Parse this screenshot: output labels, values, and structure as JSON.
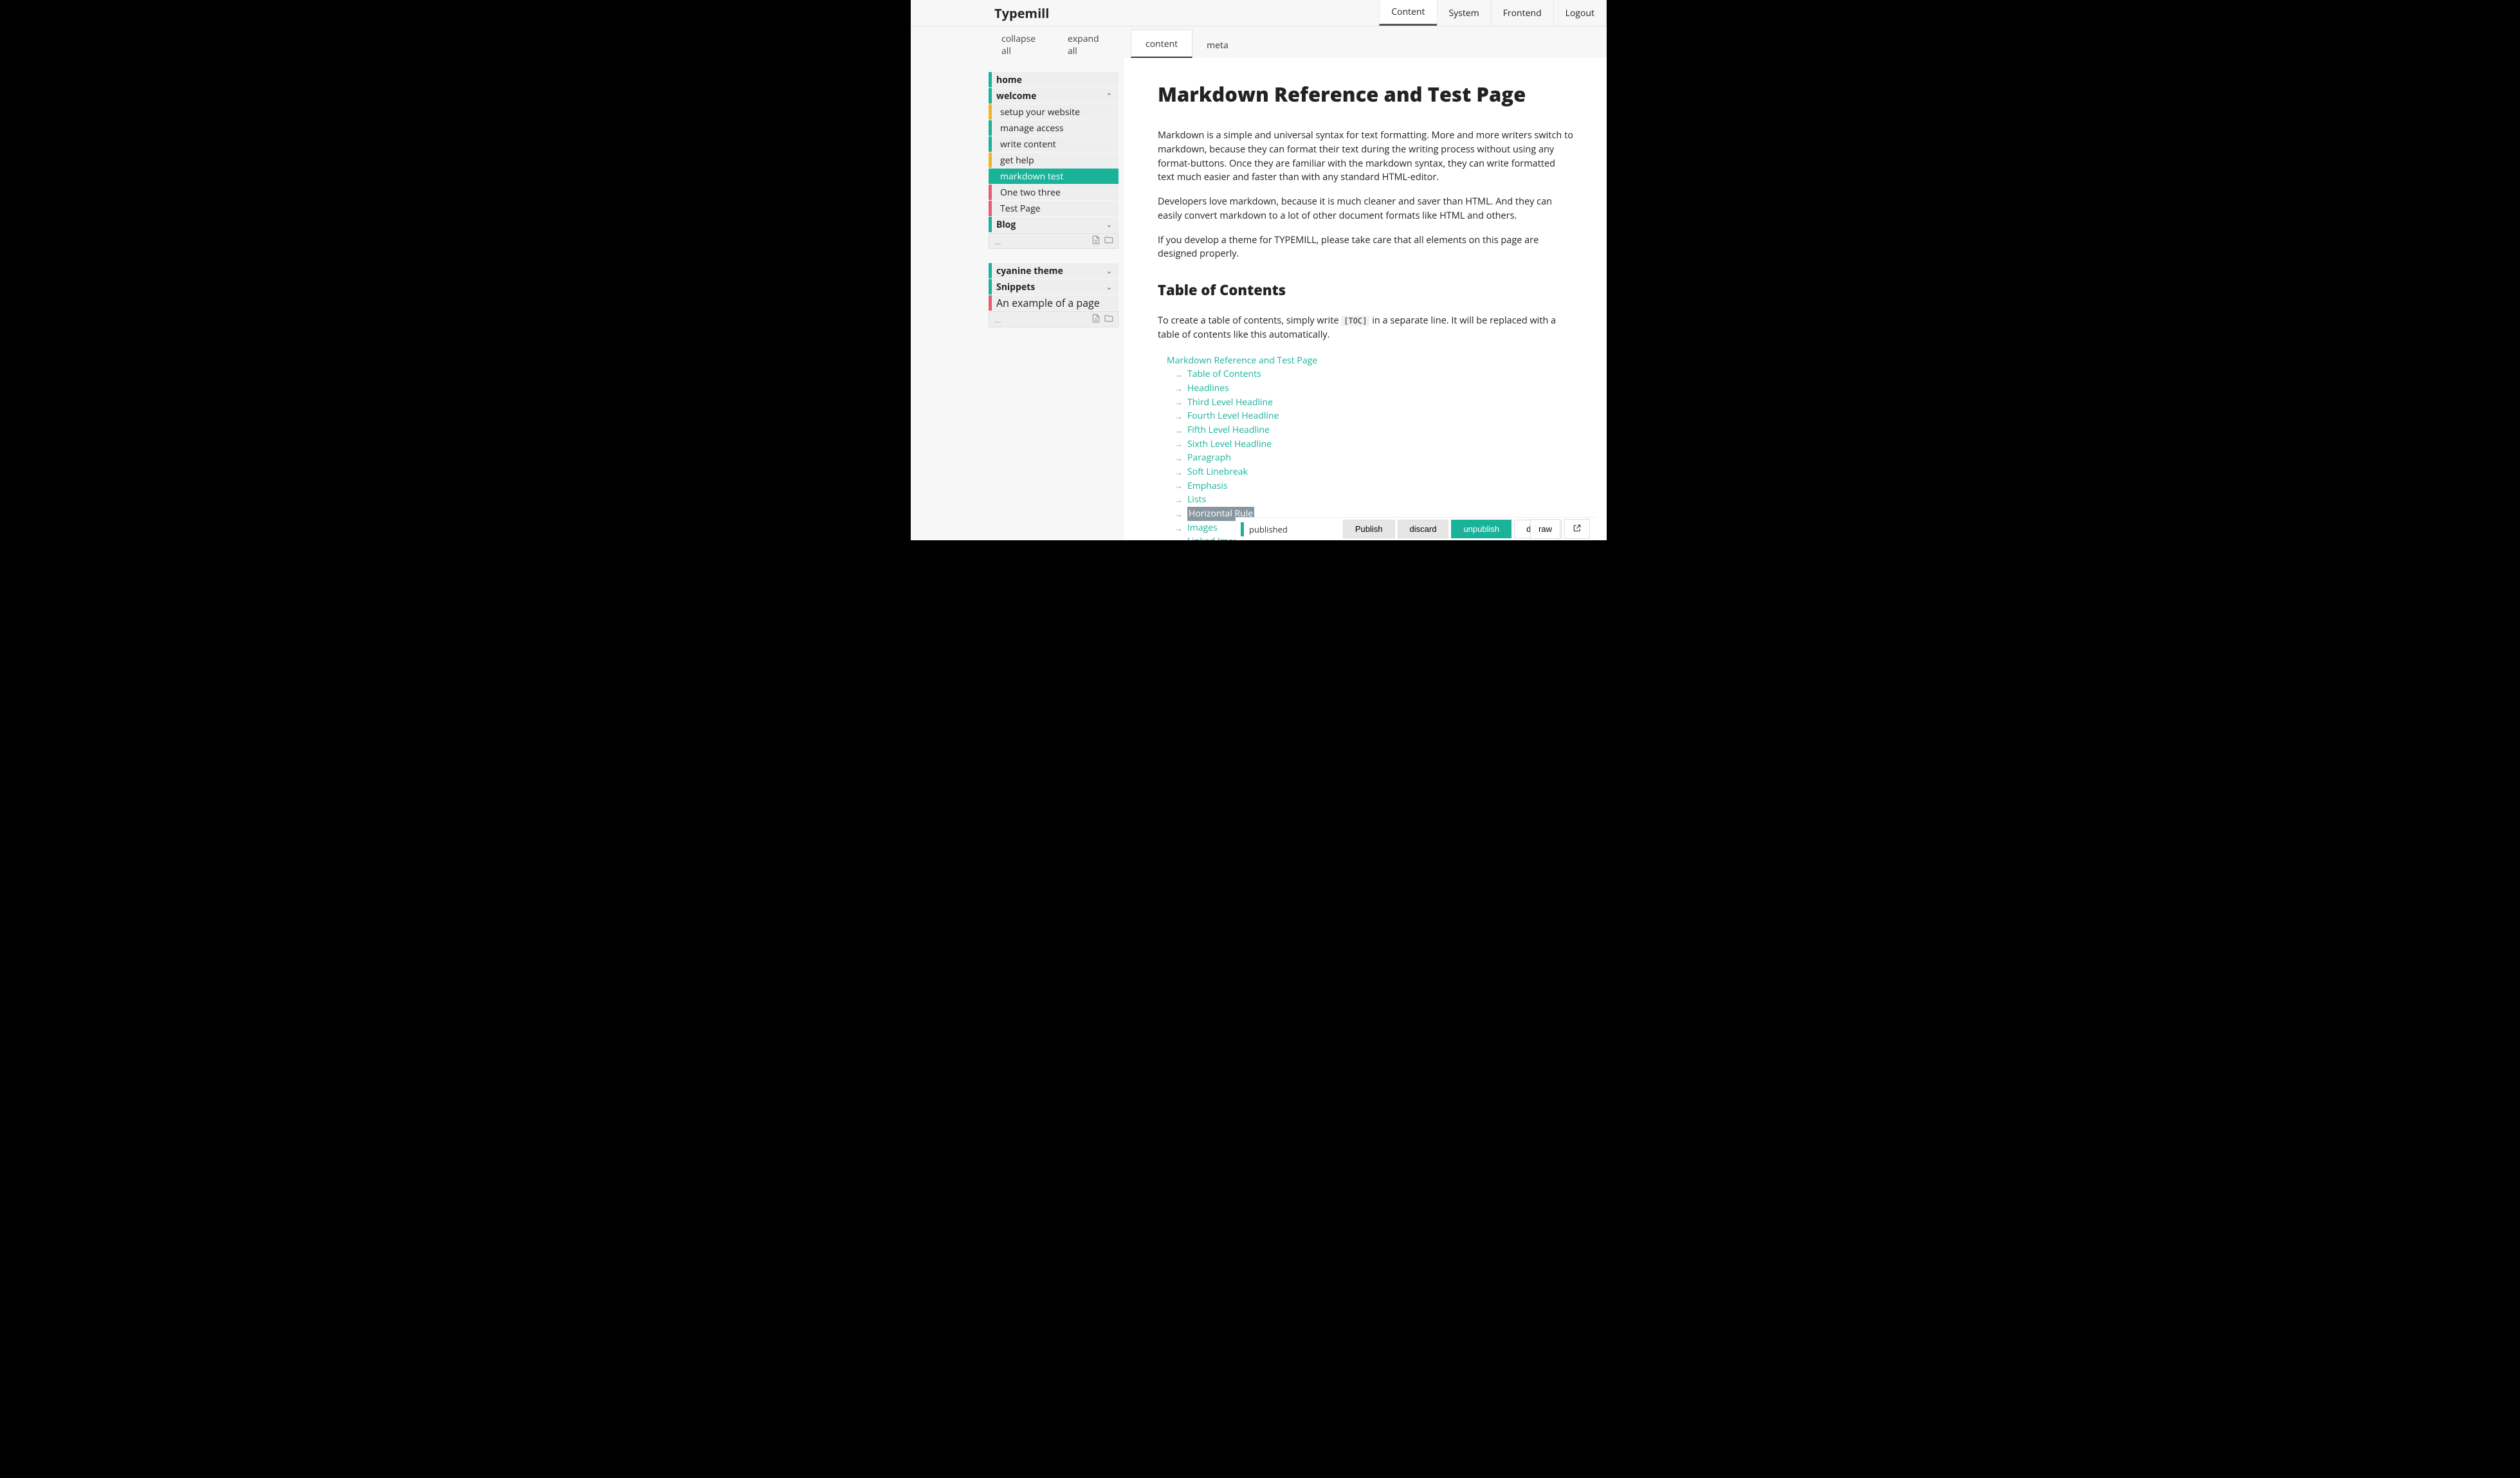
{
  "app_name": "Typemill",
  "topnav": [
    {
      "label": "Content",
      "active": true
    },
    {
      "label": "System",
      "active": false
    },
    {
      "label": "Frontend",
      "active": false
    },
    {
      "label": "Logout",
      "active": false
    }
  ],
  "sidebar_actions": {
    "collapse": "collapse all",
    "expand": "expand all"
  },
  "nav_group1": [
    {
      "label": "home",
      "color": "teal",
      "top": true
    },
    {
      "label": "welcome",
      "color": "teal",
      "top": true,
      "expanded": true
    },
    {
      "label": "setup your website",
      "color": "yellow",
      "sub": true
    },
    {
      "label": "manage access",
      "color": "teal",
      "sub": true
    },
    {
      "label": "write content",
      "color": "teal",
      "sub": true
    },
    {
      "label": "get help",
      "color": "yellow",
      "sub": true
    },
    {
      "label": "markdown test",
      "color": "teal",
      "sub": true,
      "selected": true
    },
    {
      "label": "One two three",
      "color": "pink",
      "sub": true
    },
    {
      "label": "Test Page",
      "color": "pink",
      "sub": true
    },
    {
      "label": "Blog",
      "color": "teal",
      "top": true,
      "collapsed": true
    }
  ],
  "nav_group2": [
    {
      "label": "cyanine theme",
      "color": "teal",
      "top": true,
      "collapsed": true
    },
    {
      "label": "Snippets",
      "color": "teal",
      "top": true,
      "collapsed": true
    },
    {
      "label": "An example of a page",
      "color": "pink",
      "top": false
    }
  ],
  "add_placeholder": "...",
  "tabs": {
    "content": "content",
    "meta": "meta"
  },
  "article": {
    "title": "Markdown Reference and Test Page",
    "p1": "Markdown is a simple and universal syntax for text formatting. More and more writers switch to markdown, because they can format their text during the writing process without using any format-buttons. Once they are familiar with the markdown syntax, they can write formatted text much easier and faster than with any standard HTML-editor.",
    "p2": "Developers love markdown, because it is much cleaner and saver than HTML. And they can easily convert markdown to a lot of other document formats like HTML and others.",
    "p3": "If you develop a theme for TYPEMILL, please take care that all elements on this page are designed properly.",
    "toc_heading": "Table of Contents",
    "toc_intro_pre": "To create a table of contents, simply write ",
    "toc_code": "[TOC]",
    "toc_intro_post": " in a separate line. It will be replaced with a table of contents like this automatically."
  },
  "toc": [
    {
      "label": "Markdown Reference and Test Page",
      "level": 1
    },
    {
      "label": "Table of Contents",
      "level": 2
    },
    {
      "label": "Headlines",
      "level": 2
    },
    {
      "label": "Third Level Headline",
      "level": 2
    },
    {
      "label": "Fourth Level Headline",
      "level": 2
    },
    {
      "label": "Fifth Level Headline",
      "level": 2
    },
    {
      "label": "Sixth Level Headline",
      "level": 2
    },
    {
      "label": "Paragraph",
      "level": 2
    },
    {
      "label": "Soft Linebreak",
      "level": 2
    },
    {
      "label": "Emphasis",
      "level": 2
    },
    {
      "label": "Lists",
      "level": 2
    },
    {
      "label": "Horizontal Rule",
      "level": 2,
      "highlighted": true
    },
    {
      "label": "Images",
      "level": 2
    },
    {
      "label": "Linked Images",
      "level": 2
    }
  ],
  "footer": {
    "status": "published",
    "publish": "Publish",
    "discard": "discard",
    "unpublish": "unpublish",
    "delete": "delete",
    "raw": "raw"
  }
}
